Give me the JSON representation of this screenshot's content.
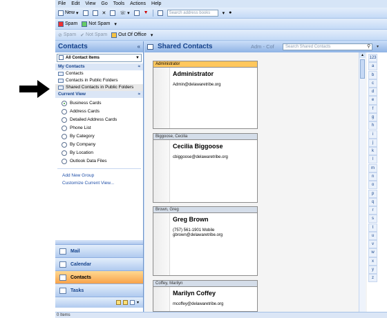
{
  "menu": [
    "File",
    "Edit",
    "View",
    "Go",
    "Tools",
    "Actions",
    "Help"
  ],
  "toolbar1": {
    "new_label": "New",
    "search_placeholder": "Search address books"
  },
  "toolbar2": {
    "spam": "Spam",
    "not_spam": "Not Spam"
  },
  "toolbar3": {
    "spam": "Spam",
    "not_spam": "Not Spam",
    "out_of_office": "Out Of Office"
  },
  "nav": {
    "title": "Contacts",
    "collapse_glyph": "«",
    "dropdown_label": "All Contact Items",
    "my_contacts_title": "My Contacts",
    "folders": [
      "Contacts",
      "Contacts in Public Folders",
      "Shared Contacts in Public Folders"
    ],
    "current_view_title": "Current View",
    "views": [
      "Business Cards",
      "Address Cards",
      "Detailed Address Cards",
      "Phone List",
      "By Category",
      "By Company",
      "By Location",
      "Outlook Data Files"
    ],
    "selected_view": "Business Cards",
    "links": [
      "Add New Group",
      "Customize Current View..."
    ],
    "buttons": [
      "Mail",
      "Calendar",
      "Contacts",
      "Tasks"
    ],
    "active_button": "Contacts"
  },
  "content": {
    "title": "Shared Contacts",
    "subtitle": "Adm - Cof",
    "search_placeholder": "Search Shared Contacts"
  },
  "cards": [
    {
      "header": "Administrator",
      "name": "Administrator",
      "lines": [
        "Admin@delawaretribe.org"
      ],
      "selected": true
    },
    {
      "header": "Biggoose, Cecilia",
      "name": "Cecilia Biggoose",
      "lines": [
        "cbiggoose@delawaretribe.org"
      ],
      "selected": false
    },
    {
      "header": "Brown, Greg",
      "name": "Greg Brown",
      "lines": [
        "(757) 561-1901 Mobile",
        "gbrown@delawaretribe.org"
      ],
      "selected": false
    },
    {
      "header": "Coffey, Marilyn",
      "name": "Marilyn Coffey",
      "lines": [
        "mcoffey@delawaretribe.org"
      ],
      "selected": false
    }
  ],
  "alphabet": [
    "123",
    "a",
    "b",
    "c",
    "d",
    "e",
    "f",
    "g",
    "h",
    "i",
    "j",
    "k",
    "l",
    "m",
    "n",
    "o",
    "p",
    "q",
    "r",
    "s",
    "t",
    "u",
    "v",
    "w",
    "x",
    "y",
    "z"
  ],
  "status": "0 Items",
  "colors": {
    "header": "#15428b",
    "selected_card": "#ffc75d",
    "active_nav": "#f8a24a"
  }
}
